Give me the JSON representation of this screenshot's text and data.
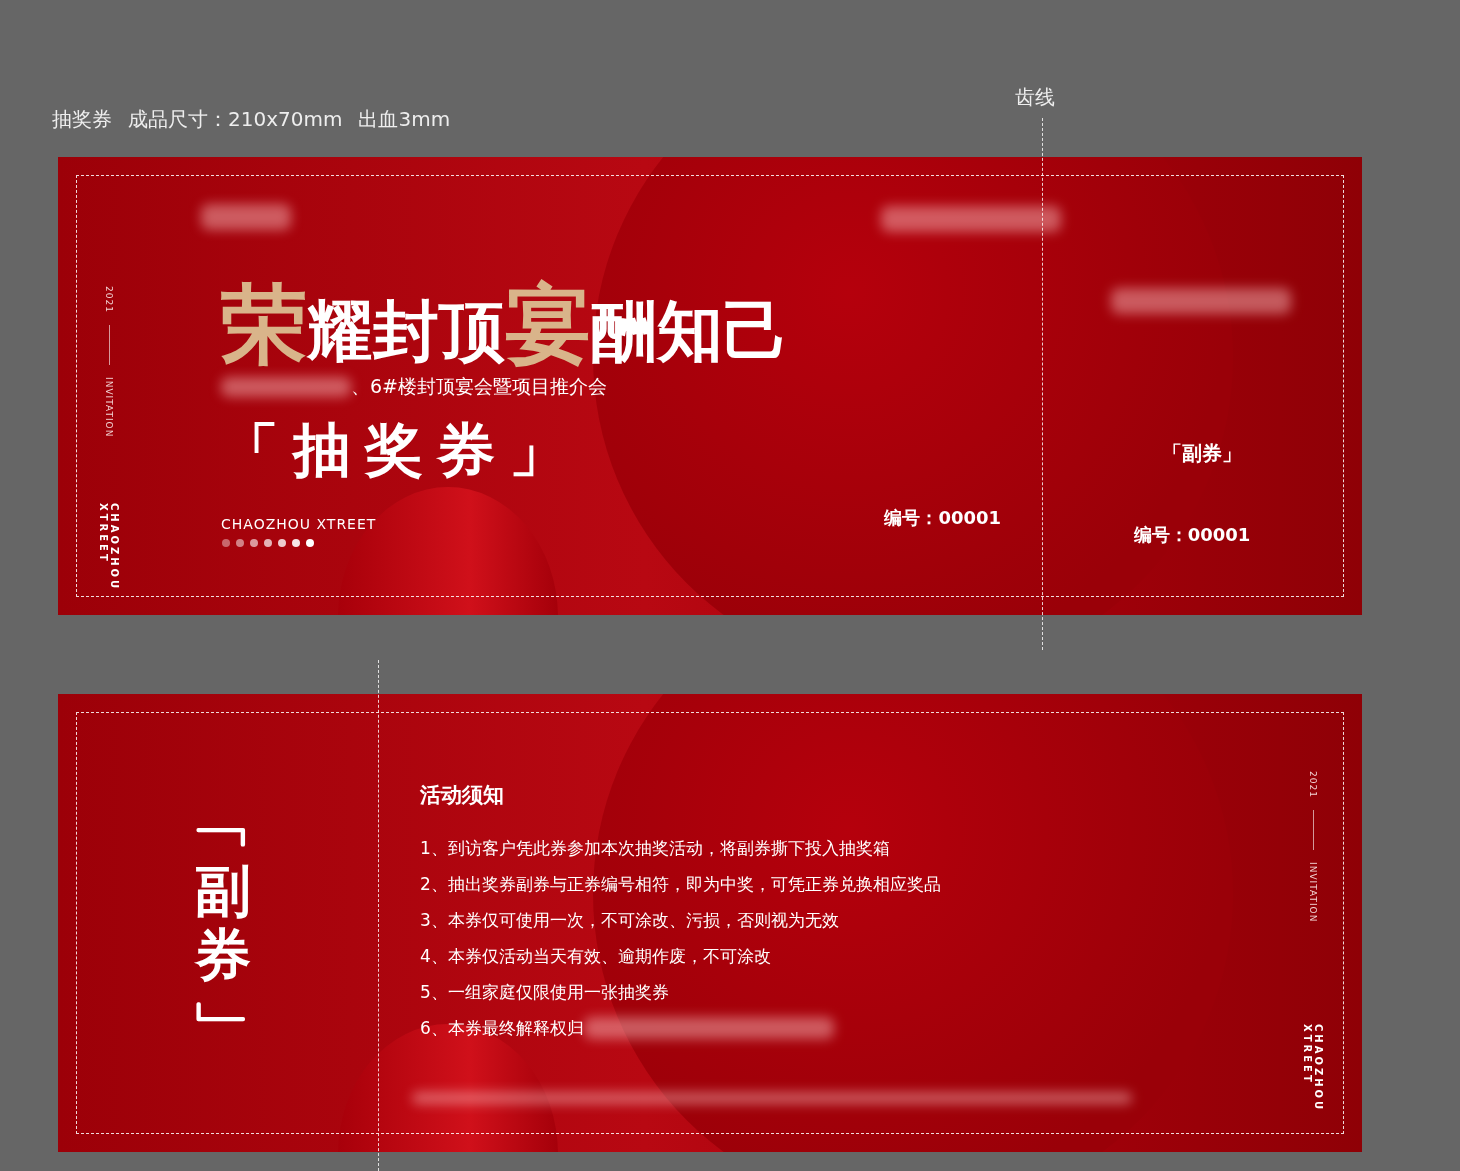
{
  "spec_labels": [
    "抽奖券",
    "成品尺寸：210x70mm",
    "出血3mm"
  ],
  "perforation_label": "齿线",
  "front": {
    "side": {
      "year": "2021",
      "tag": "INVITATION",
      "brand_lines": [
        "CHAOZHOU",
        "XTREET"
      ]
    },
    "title_parts": [
      {
        "text": "荣",
        "kind": "brush"
      },
      {
        "text": "耀封顶",
        "kind": "plain"
      },
      {
        "text": "宴",
        "kind": "brush"
      },
      {
        "text": "酬知己",
        "kind": "plain"
      }
    ],
    "subtitle": "、6#楼封顶宴会暨项目推介会",
    "ticket_name": "「抽奖券」",
    "brand": "CHAOZHOU XTREET",
    "serial": "编号：00001"
  },
  "stub": {
    "name": "「副券」",
    "serial": "编号：00001"
  },
  "back": {
    "stub_name": "﹁副券﹂",
    "notice_title": "活动须知",
    "rules": [
      "1、到访客户凭此券参加本次抽奖活动，将副券撕下投入抽奖箱",
      "2、抽出奖券副券与正券编号相符，即为中奖，可凭正券兑换相应奖品",
      "3、本券仅可使用一次，不可涂改、污损，否则视为无效",
      "4、本券仅活动当天有效、逾期作废，不可涂改",
      "5、一组家庭仅限使用一张抽奖券",
      "6、本券最终解释权归"
    ],
    "side": {
      "year": "2021",
      "tag": "INVITATION",
      "brand_lines": [
        "CHAOZHOU",
        "XTREET"
      ]
    }
  }
}
